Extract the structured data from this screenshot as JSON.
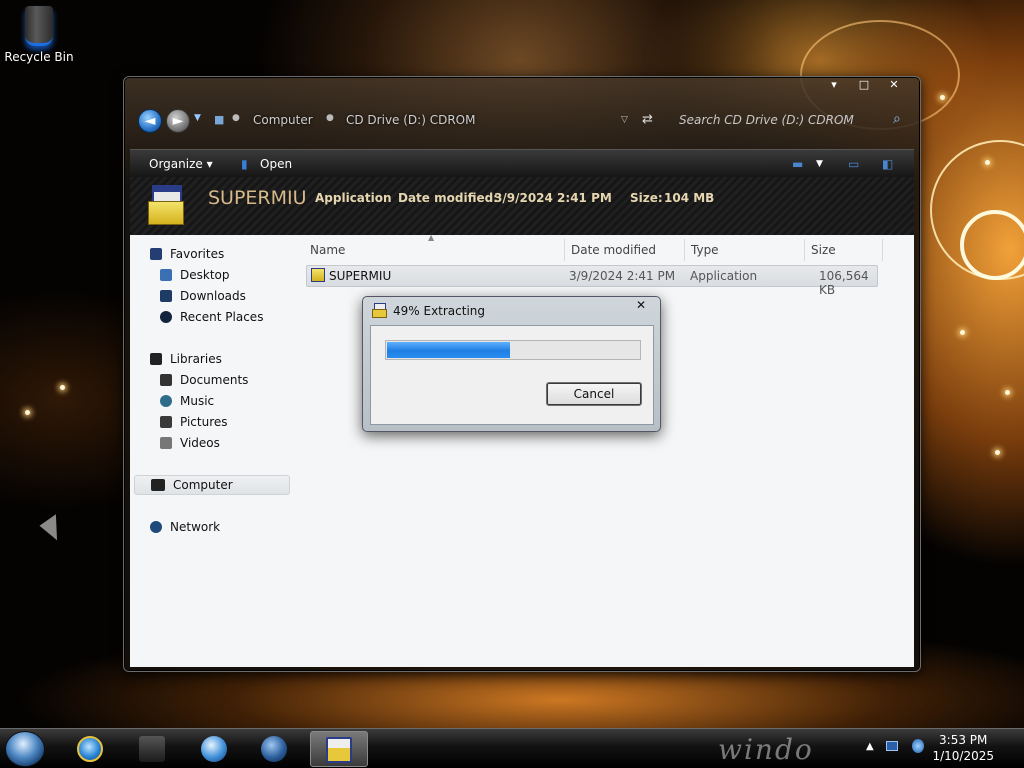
{
  "desktop": {
    "icons": [
      {
        "label": "Recycle Bin",
        "icon": "recycle-bin-icon"
      }
    ]
  },
  "window": {
    "caption_buttons": {
      "minimize": "▾",
      "maximize": "□",
      "close": "✕"
    },
    "breadcrumb": [
      "Computer",
      "CD Drive (D:) CDROM"
    ],
    "search_placeholder": "Search CD Drive (D:) CDROM",
    "toolbar": {
      "organize": "Organize ▾",
      "open": "Open"
    },
    "details": {
      "name": "SUPERMIU",
      "type": "Application",
      "date_label": "Date modified:",
      "date_value": "3/9/2024 2:41 PM",
      "size_label": "Size:",
      "size_value": "104 MB"
    },
    "sidebar": {
      "favorites": "Favorites",
      "favorites_items": [
        "Desktop",
        "Downloads",
        "Recent Places"
      ],
      "libraries": "Libraries",
      "libraries_items": [
        "Documents",
        "Music",
        "Pictures",
        "Videos"
      ],
      "computer": "Computer",
      "network": "Network"
    },
    "columns": [
      "Name",
      "Date modified",
      "Type",
      "Size"
    ],
    "files": [
      {
        "name": "SUPERMIU",
        "date": "3/9/2024 2:41 PM",
        "type": "Application",
        "size": "106,564 KB"
      }
    ]
  },
  "dialog": {
    "title": "49% Extracting",
    "close": "✕",
    "progress_fraction": 0.49,
    "cancel": "Cancel"
  },
  "taskbar": {
    "brand": "windo",
    "time": "3:53 PM",
    "date": "1/10/2025",
    "tray_arrow": "▲"
  },
  "colors": {
    "progress": "#1f7fe4",
    "details_accent": "#f0b45a"
  }
}
